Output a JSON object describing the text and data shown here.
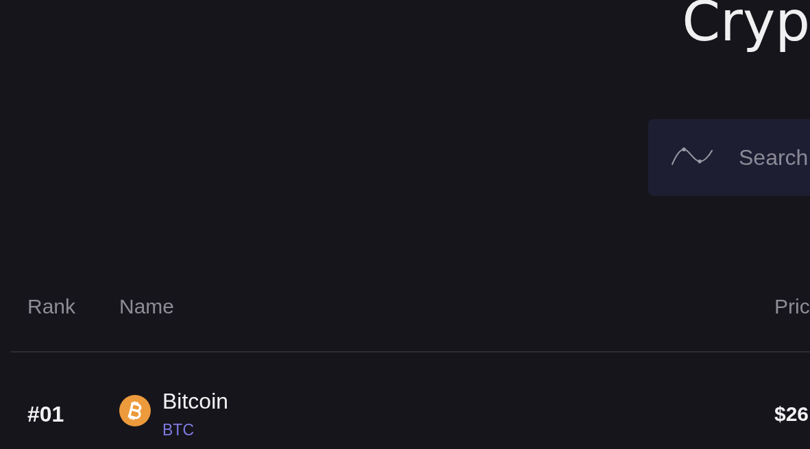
{
  "title": "Cryp",
  "search": {
    "placeholder": "Search"
  },
  "table": {
    "columns": [
      "Rank",
      "Name",
      "Pric"
    ],
    "rows": [
      {
        "rank": "#01",
        "name": "Bitcoin",
        "symbol": "BTC",
        "price": "$26"
      }
    ]
  }
}
